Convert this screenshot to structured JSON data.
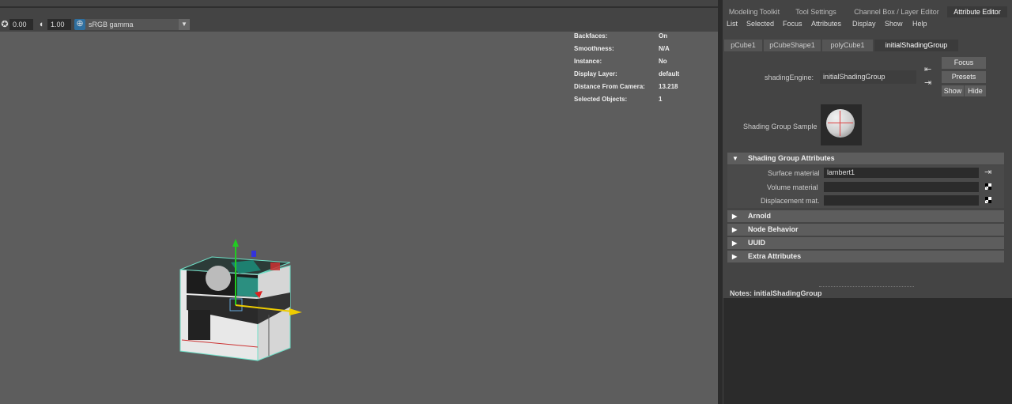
{
  "viewport": {
    "toolbar": {
      "exposure_value": "0.00",
      "gamma_value": "1.00",
      "color_space": "sRGB gamma"
    },
    "hud": [
      {
        "key": "Backfaces:",
        "value": "On"
      },
      {
        "key": "Smoothness:",
        "value": "N/A"
      },
      {
        "key": "Instance:",
        "value": "No"
      },
      {
        "key": "Display Layer:",
        "value": "default"
      },
      {
        "key": "Distance From Camera:",
        "value": "13.218"
      },
      {
        "key": "Selected Objects:",
        "value": "1"
      }
    ]
  },
  "panel": {
    "tabs": [
      "Modeling Toolkit",
      "Tool Settings",
      "Channel Box / Layer Editor",
      "Attribute Editor"
    ],
    "active_tab": "Attribute Editor",
    "menus": [
      "List",
      "Selected",
      "Focus",
      "Attributes",
      "Display",
      "Show",
      "Help"
    ],
    "node_tabs": [
      "pCube1",
      "pCubeShape1",
      "polyCube1",
      "initialShadingGroup"
    ],
    "shading_engine_label": "shadingEngine:",
    "shading_engine_value": "initialShadingGroup",
    "buttons": {
      "focus": "Focus",
      "presets": "Presets",
      "show": "Show",
      "hide": "Hide"
    },
    "sample_label": "Shading Group Sample",
    "section_main": "Shading Group Attributes",
    "attributes": [
      {
        "label": "Surface material",
        "value": "lambert1"
      },
      {
        "label": "Volume material",
        "value": ""
      },
      {
        "label": "Displacement mat.",
        "value": ""
      }
    ],
    "collapsed_sections": [
      "Arnold",
      "Node Behavior",
      "UUID",
      "Extra Attributes"
    ],
    "notes_label": "Notes:  initialShadingGroup",
    "icons": [
      "exposure-icon",
      "gamma-icon",
      "colorspace-icon",
      "input-connection-icon",
      "output-connection-icon",
      "map-checker-icon"
    ]
  }
}
